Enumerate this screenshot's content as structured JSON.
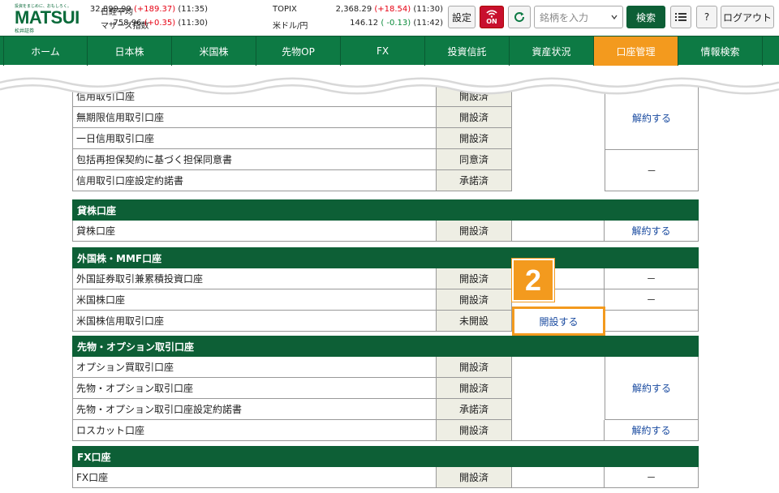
{
  "logo": {
    "tagline": "投資をまじめに、おもしろく。",
    "word": "MATSUI",
    "sub": "松井証券"
  },
  "quotes": [
    {
      "name": "日経平均",
      "value": "32,899.99",
      "change": "(+189.37)",
      "time": "(11:35)",
      "dir": "up"
    },
    {
      "name": "マザーズ指数",
      "value": "758.96",
      "change": "(+0.35)",
      "time": "(11:30)",
      "dir": "up"
    },
    {
      "name": "TOPIX",
      "value": "2,368.29",
      "change": "(+18.54)",
      "time": "(11:30)",
      "dir": "up"
    },
    {
      "name": "米ドル/円",
      "value": "146.12",
      "change": "( -0.13)",
      "time": "(11:42)",
      "dir": "down"
    }
  ],
  "header": {
    "settings": "設定",
    "on_label": "ON",
    "search_placeholder": "銘柄を入力",
    "search_button": "検索",
    "help": "?",
    "logout": "ログアウト"
  },
  "nav": [
    "ホーム",
    "日本株",
    "米国株",
    "先物OP",
    "FX",
    "投資信託",
    "資産状況",
    "口座管理",
    "情報検索"
  ],
  "nav_active": 7,
  "colors": {
    "brand_green": "#0d7a44",
    "dark_green": "#0d5f36",
    "accent_orange": "#f39a1e",
    "link_blue": "#1a4ba0"
  },
  "sections": {
    "shinyo": {
      "rows": [
        {
          "name": "信用取引口座",
          "status": "開設済"
        },
        {
          "name": "無期限信用取引口座",
          "status": "開設済"
        },
        {
          "name": "一日信用取引口座",
          "status": "開設済"
        },
        {
          "name": "包括再担保契約に基づく担保同意書",
          "status": "同意済"
        },
        {
          "name": "信用取引口座設定約諾書",
          "status": "承諾済"
        }
      ],
      "action_top": "解約する",
      "action_bottom": "－"
    },
    "kashikabu": {
      "title": "貸株口座",
      "rows": [
        {
          "name": "貸株口座",
          "status": "開設済",
          "action": "解約する"
        }
      ]
    },
    "gaikoku": {
      "title": "外国株・MMF口座",
      "rows": [
        {
          "name": "外国証券取引兼累積投資口座",
          "status": "開設済",
          "action": "－"
        },
        {
          "name": "米国株口座",
          "status": "開設済",
          "action": "－"
        },
        {
          "name": "米国株信用取引口座",
          "status": "未開設",
          "mid": "開設する"
        }
      ]
    },
    "sakimono": {
      "title": "先物・オプション取引口座",
      "rows": [
        {
          "name": "オプション買取引口座",
          "status": "開設済"
        },
        {
          "name": "先物・オプション取引口座",
          "status": "開設済"
        },
        {
          "name": "先物・オプション取引口座設定約諾書",
          "status": "承諾済"
        },
        {
          "name": "ロスカット口座",
          "status": "開設済",
          "action": "解約する"
        }
      ],
      "action_group": "解約する"
    },
    "fx": {
      "title": "FX口座",
      "rows": [
        {
          "name": "FX口座",
          "status": "開設済",
          "action": "－"
        }
      ]
    }
  },
  "step_badge": "2"
}
